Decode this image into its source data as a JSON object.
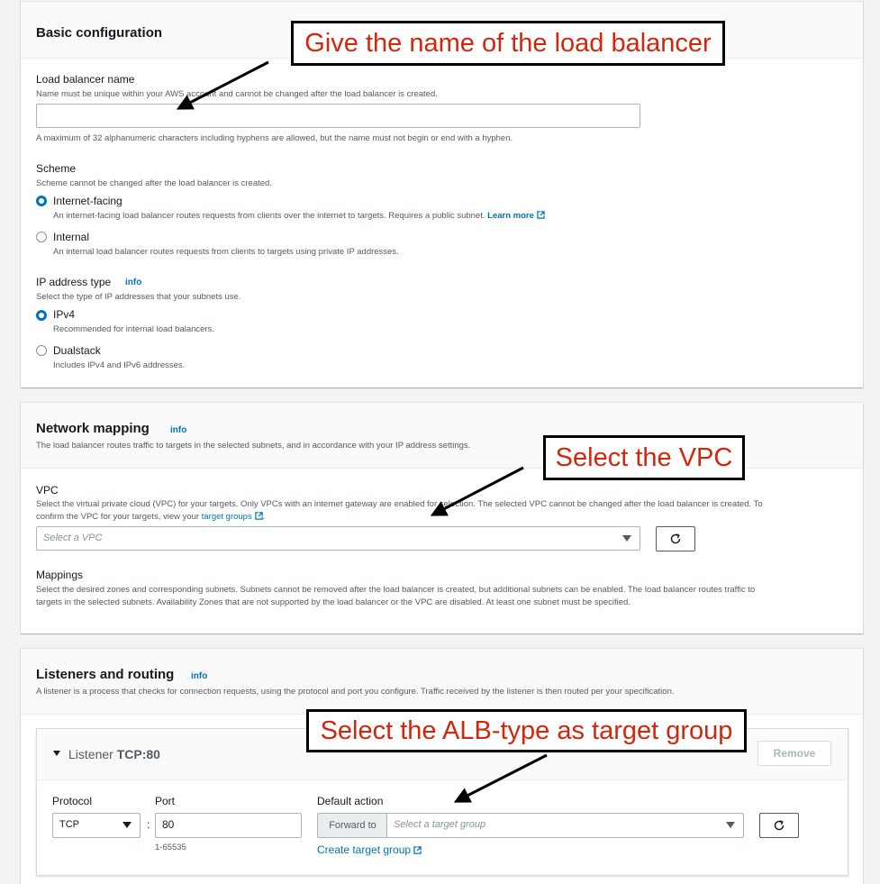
{
  "basic": {
    "title": "Basic configuration",
    "lb_name_label": "Load balancer name",
    "lb_name_help": "Name must be unique within your AWS account and cannot be changed after the load balancer is created.",
    "lb_name_value": "",
    "lb_name_constraint": "A maximum of 32 alphanumeric characters including hyphens are allowed, but the name must not begin or end with a hyphen.",
    "scheme_label": "Scheme",
    "scheme_help": "Scheme cannot be changed after the load balancer is created.",
    "scheme_options": [
      {
        "label": "Internet-facing",
        "desc": "An internet-facing load balancer routes requests from clients over the internet to targets. Requires a public subnet.",
        "link": "Learn more",
        "selected": true
      },
      {
        "label": "Internal",
        "desc": "An internal load balancer routes requests from clients to targets using private IP addresses.",
        "selected": false
      }
    ],
    "ip_label": "IP address type",
    "ip_info": "info",
    "ip_help": "Select the type of IP addresses that your subnets use.",
    "ip_options": [
      {
        "label": "IPv4",
        "desc": "Recommended for internal load balancers.",
        "selected": true
      },
      {
        "label": "Dualstack",
        "desc": "Includes IPv4 and IPv6 addresses.",
        "selected": false
      }
    ]
  },
  "network": {
    "title": "Network mapping",
    "info": "info",
    "desc": "The load balancer routes traffic to targets in the selected subnets, and in accordance with your IP address settings.",
    "vpc_label": "VPC",
    "vpc_help_1": "Select the virtual private cloud (VPC) for your targets. Only VPCs with an internet gateway are enabled for selection. The selected VPC cannot be changed after the load balancer is created. To",
    "vpc_help_2": "confirm the VPC for your targets, view your",
    "vpc_help_link": "target groups",
    "vpc_placeholder": "Select a VPC",
    "mappings_label": "Mappings",
    "mappings_help_1": "Select the desired zones and corresponding subnets. Subnets cannot be removed after the load balancer is created, but additional subnets can be enabled. The load balancer routes traffic to",
    "mappings_help_2": "targets in the selected subnets. Availability Zones that are not supported by the load balancer or the VPC are disabled. At least one subnet must be specified."
  },
  "listeners": {
    "title": "Listeners and routing",
    "info": "info",
    "desc": "A listener is a process that checks for connection requests, using the protocol and port you configure. Traffic received by the listener is then routed per your specification.",
    "listener_label": "Listener",
    "listener_value": "TCP:80",
    "remove_label": "Remove",
    "protocol_label": "Protocol",
    "protocol_value": "TCP",
    "port_label": "Port",
    "port_value": "80",
    "port_range": "1-65535",
    "default_action_label": "Default action",
    "forward_to": "Forward to",
    "target_placeholder": "Select a target group",
    "create_target_group": "Create target group",
    "colon": ":"
  },
  "annotations": {
    "name": "Give the name of the load balancer",
    "vpc": "Select the VPC",
    "alb": "Select the ALB-type as target group"
  },
  "colors": {
    "link": "#0073bb",
    "annotation_text": "#d4260c",
    "page_bg": "#f2f3f3"
  },
  "icons": [
    "external-link-icon",
    "refresh-icon",
    "caret-down-icon",
    "expand-triangle-icon",
    "arrow-icon"
  ]
}
